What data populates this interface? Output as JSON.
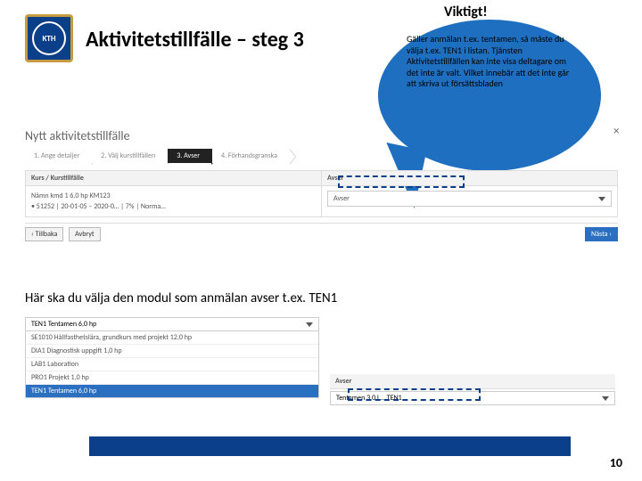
{
  "header": {
    "logo_text": "KTH",
    "title": "Aktivitetstillfälle – steg 3"
  },
  "callout": {
    "label": "Viktigt!",
    "text": "Gäller anmälan t.ex. tentamen, så måste du välja t.ex. TEN1 i listan. Tjänsten Aktivitetstillfällen kan inte visa deltagare om det inte är valt. Vilket innebär att det inte går att skriva ut försättsbladen"
  },
  "panel1": {
    "title": "Nytt aktivitetstillfälle",
    "close": "×",
    "steps": [
      "1. Ange detaljer",
      "2. Välj kurstillfällen",
      "3. Avser",
      "4. Förhandsgranska"
    ],
    "active_step_index": 2,
    "left_header": "Kurs / Kurstillfälle",
    "left_line1": "Nämn kmd 1  6.0 hp  KM123",
    "left_line2": "• 51252 | 20-01-05 – 2020-0… | 7% | Norma…",
    "right_header": "Avser",
    "right_value": "Avser",
    "back": "‹ Tillbaka",
    "cancel": "Avbryt",
    "next": "Nästa ›"
  },
  "instruction": "Här ska du välja den modul som anmälan avser t.ex. TEN1",
  "panel2": {
    "selected": "TEN1 Tentamen 6,0 hp",
    "items": [
      "SE1010 Hållfasthetslära, grundkurs med projekt 12,0 hp",
      "DIA1 Diagnostisk uppgift 1,0 hp",
      "LAB1 Laboration",
      "PRO1 Projekt 1,0 hp",
      "TEN1 Tentamen 6,0 hp"
    ],
    "highlight_index": 4
  },
  "panel3": {
    "header": "Avser",
    "value": "Tentamen 3,0 L…  TEN1"
  },
  "footer": {
    "page": "10"
  }
}
